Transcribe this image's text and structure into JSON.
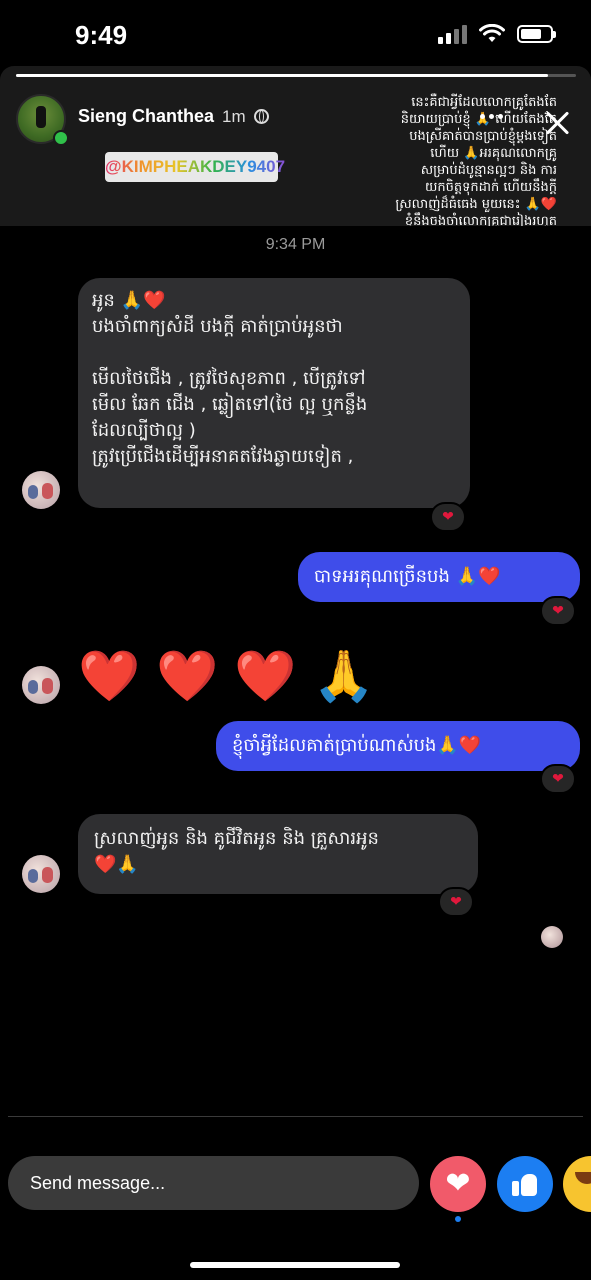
{
  "status_bar": {
    "time": "9:49",
    "battery_level": 0.72
  },
  "story": {
    "progress": 0.95,
    "author_name": "Sieng Chanthea",
    "posted_ago": "1m",
    "mention_tag": "@KIMPHEAKDEY9407",
    "caption_lines": [
      "នេះគឺជាអ្វីដែលលោកគ្រូតែងតែ",
      "និយាយប្រាប់ខ្ញុំ 🙏 ហើយតែងតែ",
      "បងស្រីគាត់បានប្រាប់ខ្ញុំម្តងទៀត",
      "ហើយ 🙏អរគុណលោកគ្រូ",
      "សម្រាប់ដំបូន្មានល្អៗ និង ការ",
      "យកចិត្តទុកដាក់ ហើយនឹងក្តី",
      "ស្រលាញ់ដ៏ធំធេង មួយនេះ 🙏❤️",
      "ខ្ញុំនឹងចងចាំលោកគ្រូជារៀងរហូត",
      "🙏❤️"
    ]
  },
  "chat": {
    "timestamp": "9:34 PM",
    "messages": [
      {
        "direction": "in",
        "lines": [
          "អូន 🙏❤️",
          "បងចាំពាក្យសំដី បងក្តី គាត់ប្រាប់អូនថា",
          "",
          "មើលថៃជើង , ត្រូវថៃសុខភាព , បើត្រូវទៅ",
          "មើល ឆែក ជើង , ឆ្លៀតទៅ(ថៃ ល្អ ឬកន្លឹង",
          "ដែលល្បីថាល្អ )",
          "ត្រូវប្រើជើងដើម្បីអនាគតវែងឆ្ងាយទៀត ,"
        ],
        "reaction": "❤"
      },
      {
        "direction": "out",
        "lines": [
          "បាទអរគុណច្រើនបង 🙏❤️"
        ],
        "reaction": "❤"
      },
      {
        "direction": "in",
        "emoji": "❤️ ❤️ ❤️ 🙏"
      },
      {
        "direction": "out",
        "lines": [
          "ខ្ញុំចាំអ្វីដែលគាត់ប្រាប់ណាស់បង🙏❤️"
        ],
        "reaction": "❤"
      },
      {
        "direction": "in",
        "lines": [
          "ស្រលាញ់អូន និង គូជីវិតអូន និង គ្រួសារអូន",
          "❤️🙏"
        ],
        "reaction": "❤"
      }
    ]
  },
  "composer": {
    "placeholder": "Send message...",
    "quick_reactions": [
      "heart",
      "like",
      "haha"
    ]
  }
}
